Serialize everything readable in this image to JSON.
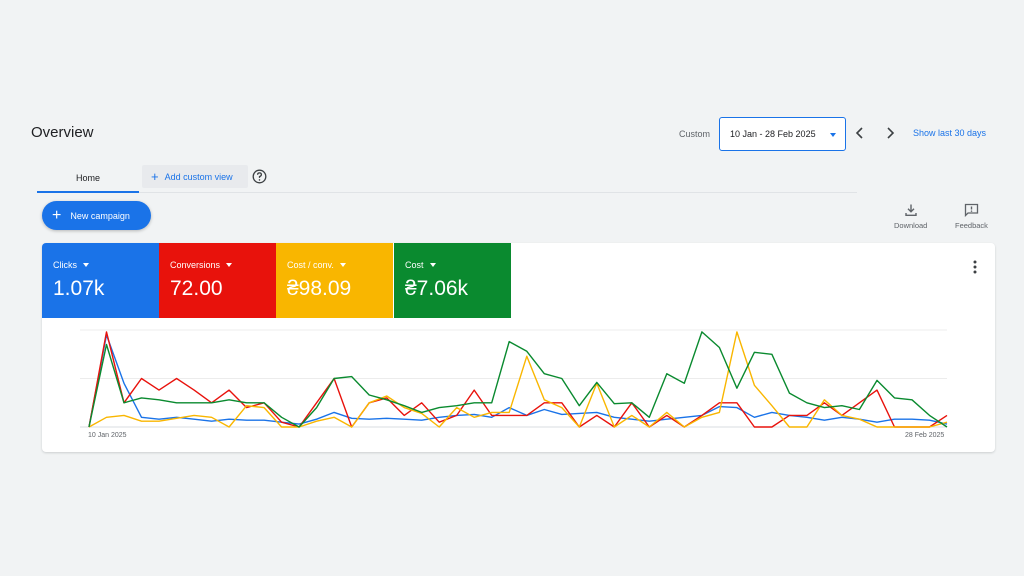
{
  "header": {
    "title": "Overview",
    "custom_label": "Custom",
    "date_range": "10 Jan - 28 Feb 2025",
    "show_last": "Show last 30 days"
  },
  "tabs": {
    "home": "Home",
    "add_custom_view": "Add custom view"
  },
  "actions": {
    "new_campaign": "New campaign",
    "download": "Download",
    "feedback": "Feedback"
  },
  "metrics": [
    {
      "label": "Clicks",
      "value": "1.07k",
      "color": "#1a73e8"
    },
    {
      "label": "Conversions",
      "value": "72.00",
      "color": "#e8120c"
    },
    {
      "label": "Cost / conv.",
      "value": "₴98.09",
      "color": "#f9b600"
    },
    {
      "label": "Cost",
      "value": "₴7.06k",
      "color": "#0a8a2f"
    }
  ],
  "chart_data": {
    "type": "line",
    "x_start_label": "10 Jan 2025",
    "x_end_label": "28 Feb 2025",
    "grid": true,
    "series": [
      {
        "name": "Clicks",
        "color": "#1a73e8",
        "values": [
          0.0,
          0.95,
          0.45,
          0.1,
          0.08,
          0.1,
          0.08,
          0.06,
          0.08,
          0.07,
          0.07,
          0.05,
          0.03,
          0.08,
          0.15,
          0.09,
          0.08,
          0.09,
          0.08,
          0.07,
          0.1,
          0.12,
          0.13,
          0.1,
          0.2,
          0.12,
          0.18,
          0.13,
          0.14,
          0.15,
          0.1,
          0.08,
          0.06,
          0.08,
          0.1,
          0.12,
          0.21,
          0.2,
          0.1,
          0.15,
          0.12,
          0.1,
          0.07,
          0.1,
          0.08,
          0.05,
          0.08,
          0.08,
          0.07,
          0.03
        ]
      },
      {
        "name": "Conversions",
        "color": "#e8120c",
        "values": [
          0.0,
          0.98,
          0.25,
          0.5,
          0.38,
          0.5,
          0.38,
          0.25,
          0.38,
          0.2,
          0.25,
          0.05,
          0.0,
          0.25,
          0.5,
          0.0,
          0.25,
          0.3,
          0.12,
          0.25,
          0.05,
          0.12,
          0.38,
          0.12,
          0.12,
          0.12,
          0.25,
          0.25,
          0.0,
          0.12,
          0.0,
          0.25,
          0.0,
          0.12,
          0.0,
          0.12,
          0.25,
          0.25,
          0.0,
          0.0,
          0.12,
          0.12,
          0.25,
          0.12,
          0.25,
          0.38,
          0.0,
          0.0,
          0.0,
          0.12
        ]
      },
      {
        "name": "Cost / conv.",
        "color": "#f9b600",
        "values": [
          0.0,
          0.1,
          0.12,
          0.06,
          0.06,
          0.09,
          0.12,
          0.1,
          0.0,
          0.22,
          0.2,
          0.0,
          0.0,
          0.06,
          0.1,
          0.0,
          0.25,
          0.32,
          0.2,
          0.14,
          0.0,
          0.2,
          0.1,
          0.15,
          0.15,
          0.73,
          0.28,
          0.2,
          0.0,
          0.45,
          0.0,
          0.12,
          0.0,
          0.15,
          0.0,
          0.1,
          0.15,
          0.98,
          0.43,
          0.22,
          0.0,
          0.0,
          0.28,
          0.12,
          0.08,
          0.0,
          0.0,
          0.0,
          0.0,
          0.05
        ]
      },
      {
        "name": "Cost",
        "color": "#0a8a2f",
        "values": [
          0.0,
          0.85,
          0.25,
          0.3,
          0.28,
          0.25,
          0.25,
          0.25,
          0.28,
          0.25,
          0.25,
          0.1,
          0.0,
          0.2,
          0.5,
          0.52,
          0.33,
          0.28,
          0.22,
          0.15,
          0.2,
          0.22,
          0.25,
          0.25,
          0.88,
          0.78,
          0.55,
          0.5,
          0.22,
          0.46,
          0.24,
          0.25,
          0.1,
          0.55,
          0.45,
          0.98,
          0.82,
          0.4,
          0.77,
          0.75,
          0.35,
          0.25,
          0.2,
          0.22,
          0.18,
          0.48,
          0.3,
          0.28,
          0.12,
          0.0
        ]
      }
    ]
  }
}
